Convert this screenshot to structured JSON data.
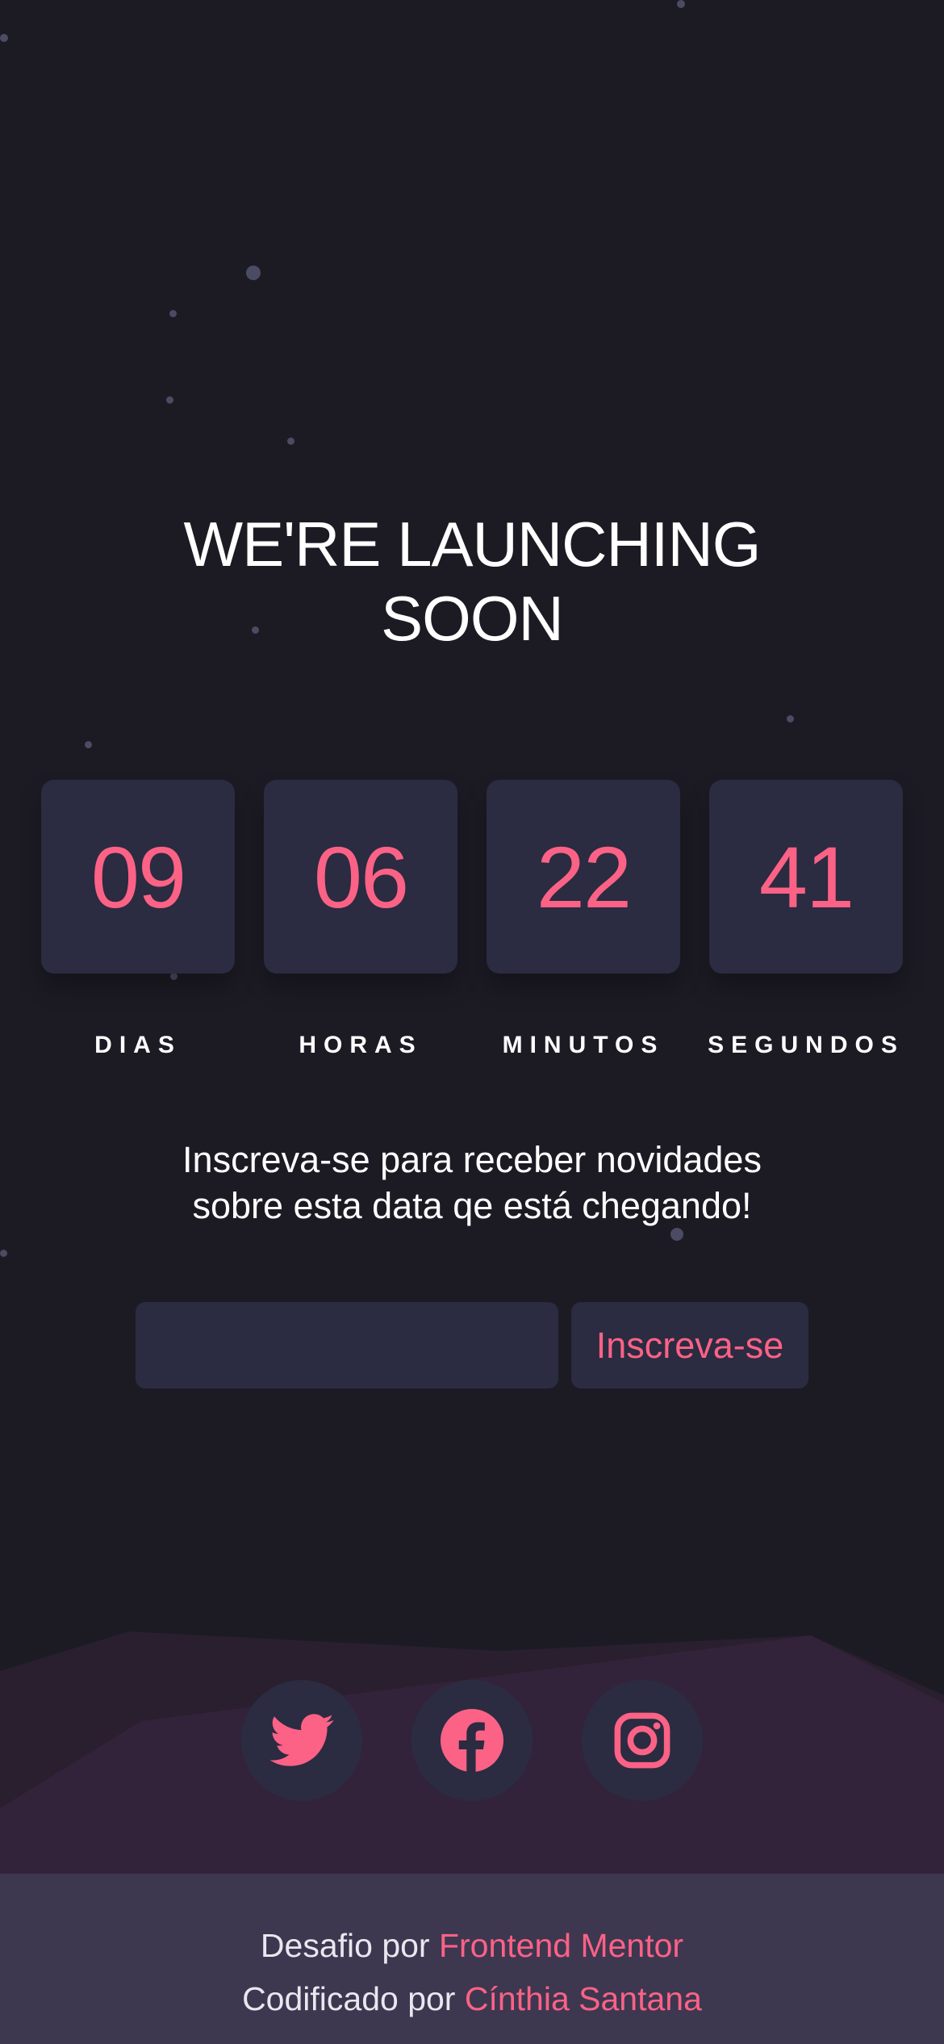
{
  "hero": {
    "title_line1": "WE'RE LAUNCHING",
    "title_line2": "SOON"
  },
  "countdown": [
    {
      "value": "09",
      "label": "DIAS"
    },
    {
      "value": "06",
      "label": "HORAS"
    },
    {
      "value": "22",
      "label": "MINUTOS"
    },
    {
      "value": "41",
      "label": "SEGUNDOS"
    }
  ],
  "newsletter": {
    "text_line1": "Inscreva-se para receber novidades",
    "text_line2": "sobre esta data qe está chegando!",
    "input_value": "",
    "button_label": "Inscreva-se"
  },
  "social": [
    "twitter-icon",
    "facebook-icon",
    "instagram-icon"
  ],
  "footer": {
    "line1_prefix": "Desafio por ",
    "line1_link": "Frontend Mentor",
    "line2_prefix": "Codificado por ",
    "line2_link": "Cínthia Santana"
  },
  "colors": {
    "background": "#1c1b24",
    "card": "#2b2b41",
    "accent": "#fb6286",
    "footer": "#3e3750",
    "hills": "#33233a"
  }
}
